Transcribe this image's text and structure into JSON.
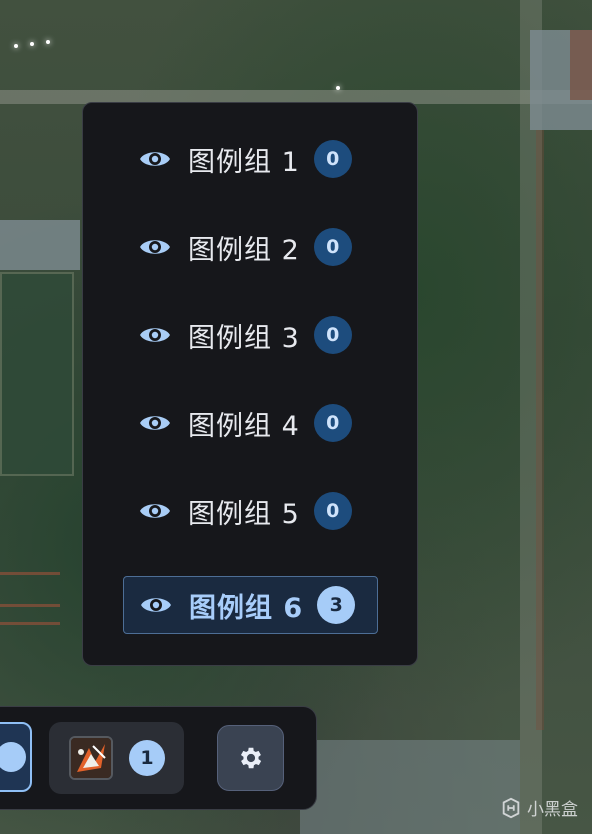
{
  "legend": {
    "items": [
      {
        "label": "图例组 1",
        "count": "0",
        "visible_icon": "eye-icon",
        "active": false
      },
      {
        "label": "图例组 2",
        "count": "0",
        "visible_icon": "eye-icon",
        "active": false
      },
      {
        "label": "图例组 3",
        "count": "0",
        "visible_icon": "eye-icon",
        "active": false
      },
      {
        "label": "图例组 4",
        "count": "0",
        "visible_icon": "eye-icon",
        "active": false
      },
      {
        "label": "图例组 5",
        "count": "0",
        "visible_icon": "eye-icon",
        "active": false
      },
      {
        "label": "图例组 6",
        "count": "3",
        "visible_icon": "eye-icon",
        "active": true
      }
    ]
  },
  "toolbar": {
    "group_count": "1",
    "group_icon": "marker-thumbnail-icon",
    "settings_icon": "gear-icon"
  },
  "watermark": {
    "text": "小黑盒",
    "icon": "heybox-logo-icon"
  },
  "colors": {
    "panel_bg": "#16171b",
    "badge_bg": "#1d4c7d",
    "accent": "#a6ccf8",
    "active_bg": "#1a2a40"
  }
}
